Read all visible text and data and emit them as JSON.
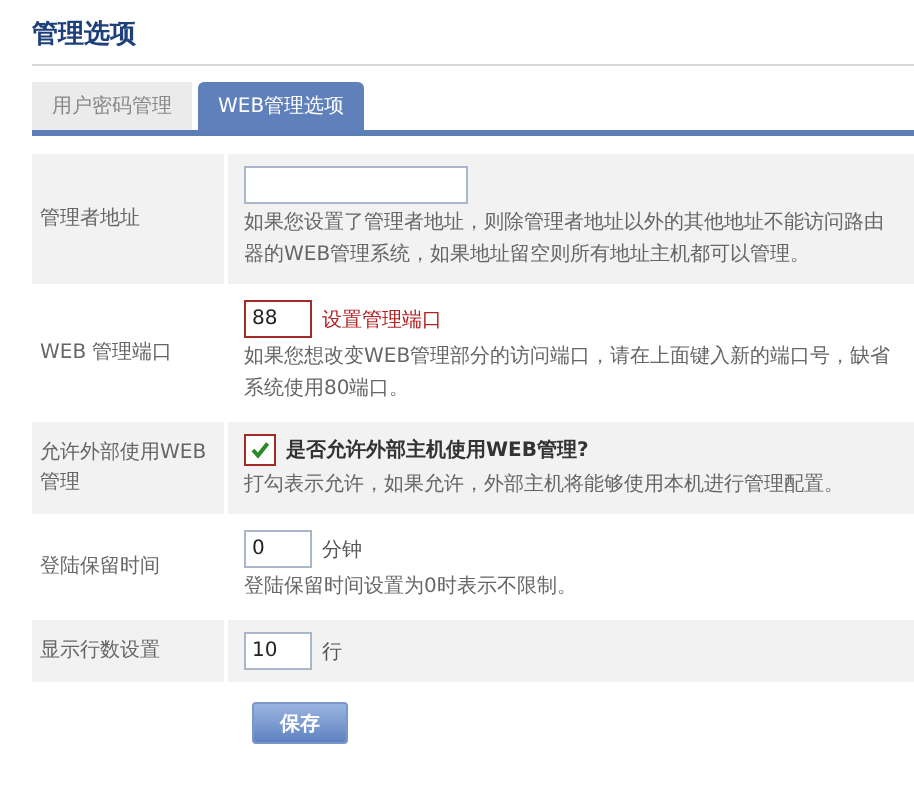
{
  "page_title": "管理选项",
  "tabs": [
    {
      "label": "用户密码管理",
      "selected": false
    },
    {
      "label": "WEB管理选项",
      "selected": true
    }
  ],
  "rows": [
    {
      "kind": "wide-field",
      "label": "管理者地址",
      "value": "",
      "description": "如果您设置了管理者地址，则除管理者地址以外的其他地址不能访问路由器的WEB管理系统，如果地址留空则所有地址主机都可以管理。",
      "shaded": true
    },
    {
      "kind": "field",
      "label": "WEB 管理端口",
      "value": "88",
      "invalid": true,
      "note": "设置管理端口",
      "description": "如果您想改变WEB管理部分的访问端口，请在上面键入新的端口号，缺省系统使用80端口。",
      "shaded": false
    },
    {
      "kind": "checkbox",
      "label": "允许外部使用WEB管理",
      "checked": true,
      "question": "是否允许外部主机使用WEB管理?",
      "description": "打勾表示允许，如果允许，外部主机将能够使用本机进行管理配置。",
      "shaded": true
    },
    {
      "kind": "field",
      "label": "登陆保留时间",
      "value": "0",
      "unit": "分钟",
      "description": "登陆保留时间设置为0时表示不限制。",
      "shaded": false
    },
    {
      "kind": "field",
      "label": "显示行数设置",
      "value": "10",
      "unit": "行",
      "shaded": true
    }
  ],
  "save_button": "保存"
}
